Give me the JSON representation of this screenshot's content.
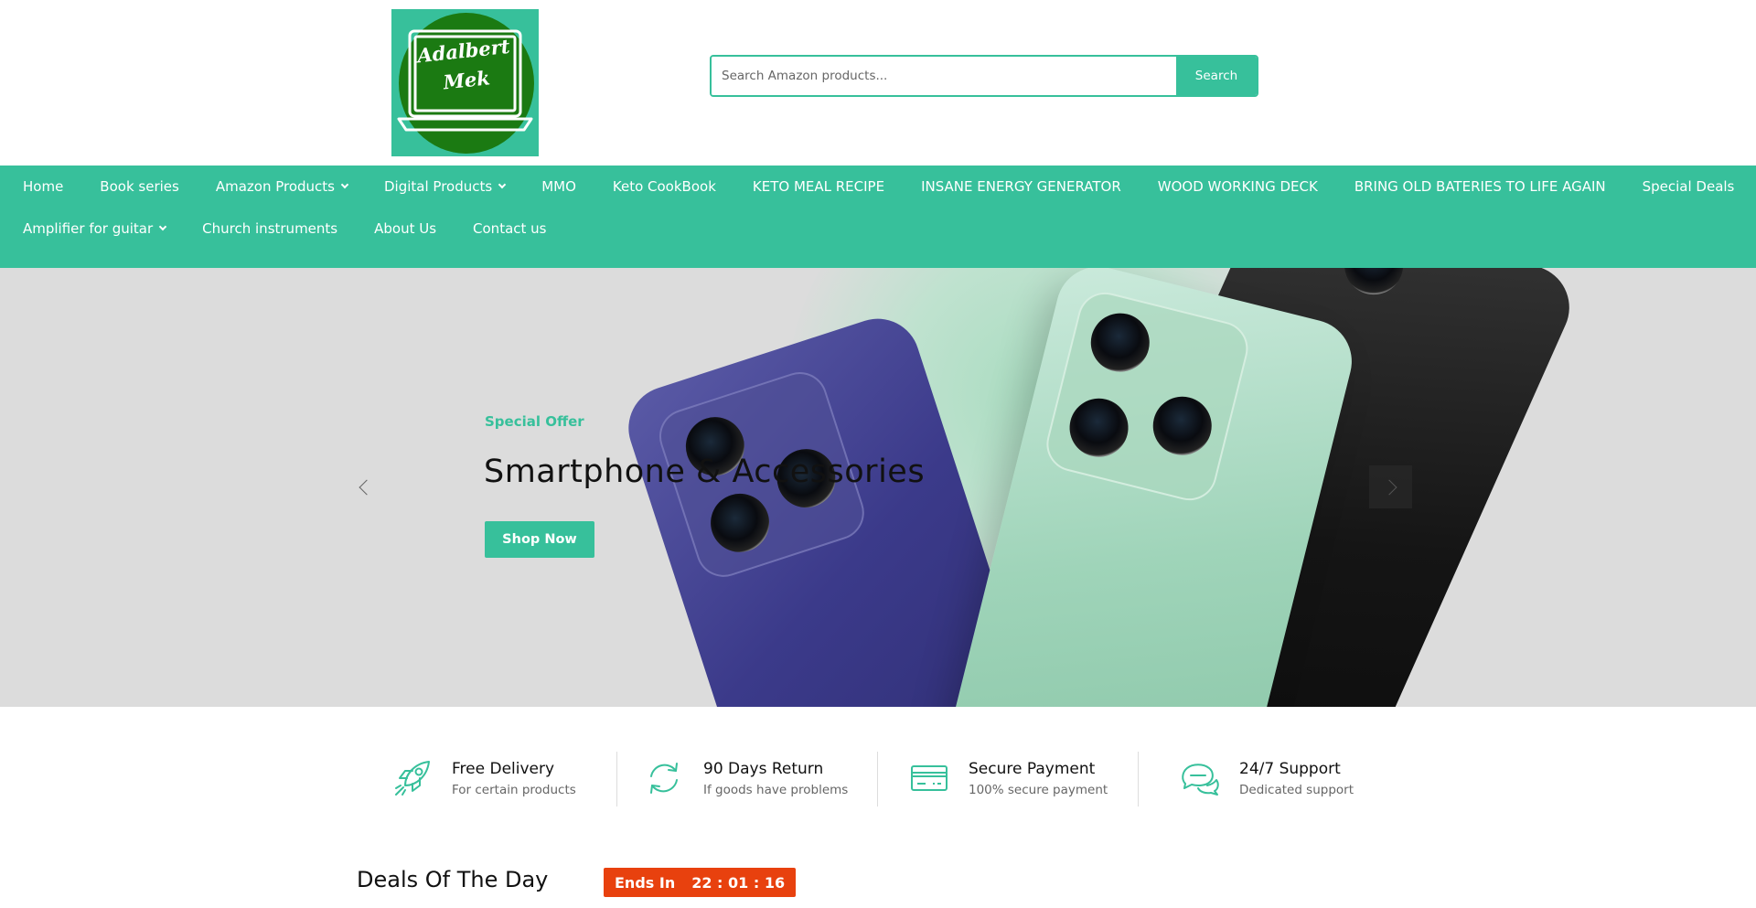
{
  "header": {
    "logo_text_line1": "Adalbert",
    "logo_text_line2": "Mek",
    "search_placeholder": "Search Amazon products...",
    "search_button": "Search"
  },
  "nav": {
    "row1": [
      {
        "label": "Home",
        "has_dropdown": false
      },
      {
        "label": "Book series",
        "has_dropdown": false
      },
      {
        "label": "Amazon Products",
        "has_dropdown": true
      },
      {
        "label": "Digital Products",
        "has_dropdown": true
      },
      {
        "label": "MMO",
        "has_dropdown": false
      },
      {
        "label": "Keto CookBook",
        "has_dropdown": false
      },
      {
        "label": "KETO MEAL RECIPE",
        "has_dropdown": false
      },
      {
        "label": "INSANE ENERGY GENERATOR",
        "has_dropdown": false
      },
      {
        "label": "WOOD WORKING DECK",
        "has_dropdown": false
      },
      {
        "label": "BRING OLD BATERIES TO LIFE AGAIN",
        "has_dropdown": false
      },
      {
        "label": "Special Deals",
        "has_dropdown": false
      }
    ],
    "row2": [
      {
        "label": "Amplifier for guitar",
        "has_dropdown": true
      },
      {
        "label": "Church instruments",
        "has_dropdown": false
      },
      {
        "label": "About Us",
        "has_dropdown": false
      },
      {
        "label": "Contact us",
        "has_dropdown": false
      }
    ]
  },
  "hero": {
    "subtitle": "Special Offer",
    "title": "Smartphone & Accessories",
    "button": "Shop Now"
  },
  "features": [
    {
      "title": "Free Delivery",
      "desc": "For certain products",
      "icon": "rocket-icon"
    },
    {
      "title": "90 Days Return",
      "desc": "If goods have problems",
      "icon": "refresh-icon"
    },
    {
      "title": "Secure Payment",
      "desc": "100% secure payment",
      "icon": "credit-card-icon"
    },
    {
      "title": "24/7 Support",
      "desc": "Dedicated support",
      "icon": "chat-bubbles-icon"
    }
  ],
  "deals": {
    "title": "Deals Of The Day",
    "ends_label": "Ends In",
    "timer": "22 : 01 : 16"
  },
  "colors": {
    "accent": "#37c09b",
    "logo_circle": "#1b7a12",
    "countdown": "#e8410e"
  }
}
